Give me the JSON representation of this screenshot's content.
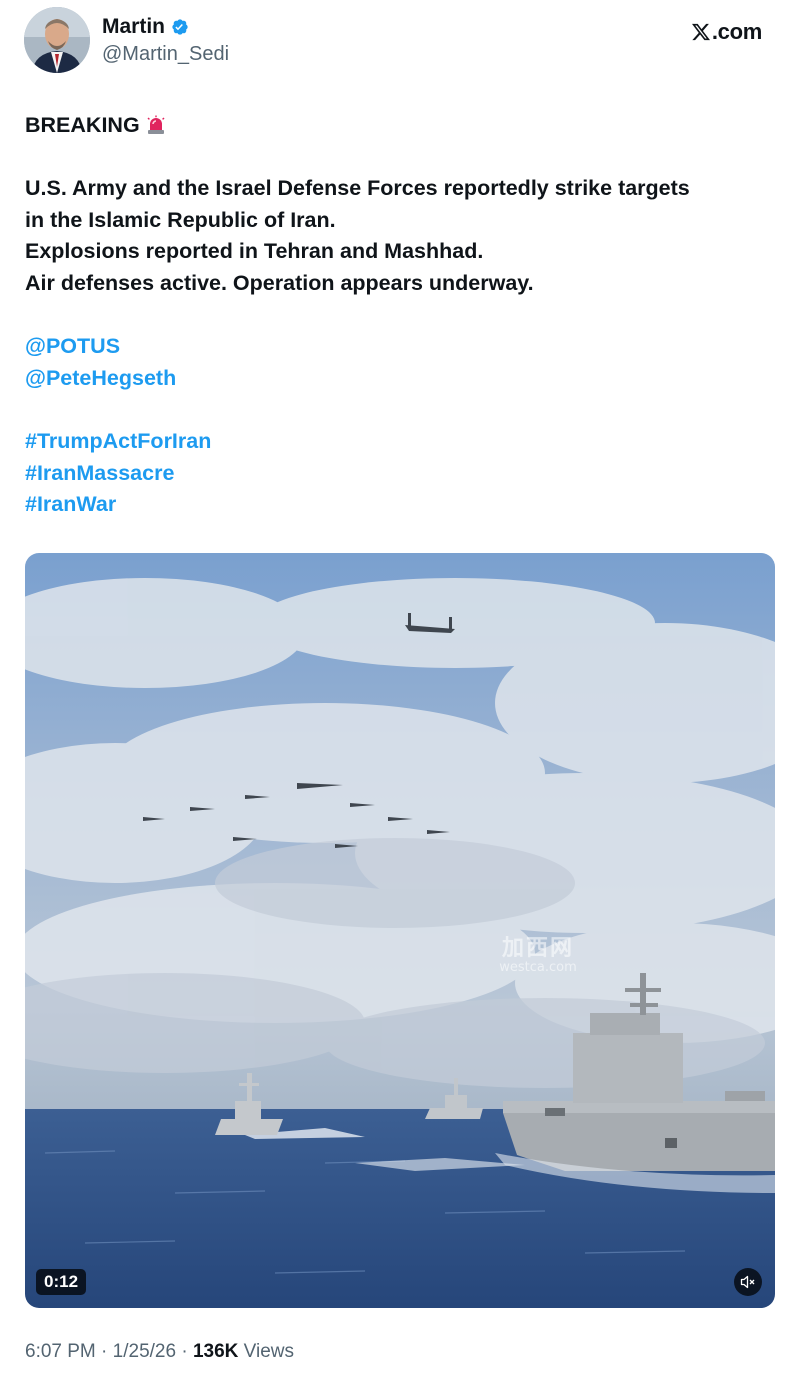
{
  "author": {
    "display_name": "Martin",
    "handle": "@Martin_Sedi",
    "verified_icon": "verified-badge-icon",
    "avatar_icon": "avatar-photo"
  },
  "site": {
    "logo_icon": "x-logo-icon",
    "label": ".com"
  },
  "tweet": {
    "headline": "BREAKING",
    "headline_icon": "siren-emoji-icon",
    "body_lines": [
      "U.S. Army and the Israel Defense Forces reportedly strike targets",
      "in the Islamic Republic of Iran.",
      "Explosions reported in Tehran and Mashhad.",
      "Air defenses active. Operation appears underway."
    ],
    "mentions": [
      "@POTUS",
      "@PeteHegseth"
    ],
    "hashtags": [
      "#TrumpActForIran",
      "#IranMassacre",
      "#IranWar"
    ]
  },
  "media": {
    "duration": "0:12",
    "mute_icon": "volume-muted-icon",
    "watermark_top": "加西网",
    "watermark_bottom": "westca.com"
  },
  "meta": {
    "time": "6:07 PM",
    "date": "1/25/26",
    "views_count": "136K",
    "views_label": "Views",
    "separator": "·"
  },
  "colors": {
    "link": "#1d9bf0",
    "text": "#0f1419",
    "secondary": "#536471",
    "verified": "#1d9bf0"
  }
}
